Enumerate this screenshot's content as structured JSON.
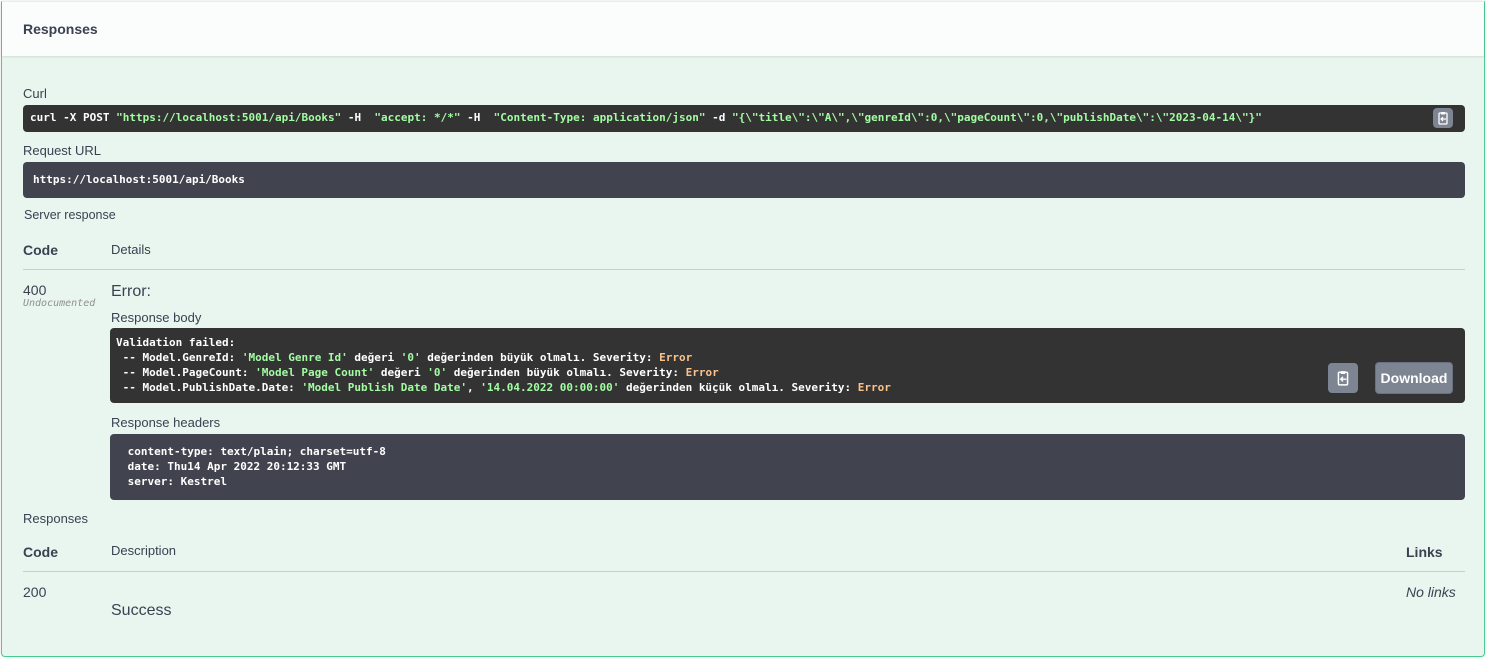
{
  "section": {
    "title": "Responses"
  },
  "curl": {
    "label": "Curl",
    "cmd_prefix": "curl -X POST ",
    "url": "\"https://localhost:5001/api/Books\"",
    "h1_flag": " -H  ",
    "h1": "\"accept: */*\"",
    "h2_flag": " -H  ",
    "h2": "\"Content-Type: application/json\"",
    "d_flag": " -d ",
    "data": "\"{\\\"title\\\":\\\"A\\\",\\\"genreId\\\":0,\\\"pageCount\\\":0,\\\"publishDate\\\":\\\"2023-04-14\\\"}\""
  },
  "request_url": {
    "label": "Request URL",
    "value": "https://localhost:5001/api/Books"
  },
  "server_response": {
    "label": "Server response",
    "col_code": "Code",
    "col_details": "Details",
    "code": "400",
    "code_note": "Undocumented",
    "error_title": "Error:",
    "body_label": "Response body",
    "body": {
      "line0": "Validation failed:",
      "lines": [
        {
          "prefix": " -- Model.GenreId: ",
          "quoted": "'Model Genre Id'",
          "mid": " değeri ",
          "value": "'0'",
          "suffix": " değerinden büyük olmalı. Severity: ",
          "severity": "Error"
        },
        {
          "prefix": " -- Model.PageCount: ",
          "quoted": "'Model Page Count'",
          "mid": " değeri ",
          "value": "'0'",
          "suffix": " değerinden büyük olmalı. Severity: ",
          "severity": "Error"
        },
        {
          "prefix": " -- Model.PublishDate.Date: ",
          "quoted": "'Model Publish Date Date'",
          "mid": ", ",
          "value": "'14.04.2022 00:00:00'",
          "suffix": " değerinden küçük olmalı. Severity: ",
          "severity": "Error"
        }
      ]
    },
    "download_label": "Download",
    "headers_label": "Response headers",
    "headers": [
      " content-type: text/plain; charset=utf-8 ",
      " date: Thu14 Apr 2022 20:12:33 GMT ",
      " server: Kestrel "
    ]
  },
  "responses": {
    "label": "Responses",
    "col_code": "Code",
    "col_description": "Description",
    "col_links": "Links",
    "rows": [
      {
        "code": "200",
        "description": "Success",
        "links": "No links"
      }
    ]
  },
  "colors": {
    "panel_bg": "#e8f6ef",
    "panel_border": "#49cc90",
    "code_bg": "#333333",
    "header_block_bg": "#41444e",
    "string_color": "#a2fca2",
    "keyword_color": "#fcc28c",
    "button_bg": "#7d8492"
  },
  "icons": [
    "copy-to-clipboard-icon"
  ]
}
